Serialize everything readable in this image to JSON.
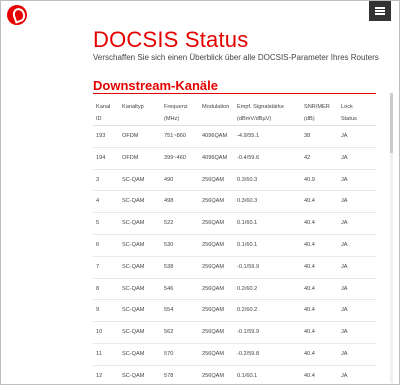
{
  "header": {
    "logo_icon": "vodafone-logo-icon",
    "menu_icon": "hamburger-menu-icon",
    "accent_color": "#e60000"
  },
  "page": {
    "title": "DOCSIS Status",
    "subtitle": "Verschaffen Sie sich einen Überblick über alle DOCSIS-Parameter Ihres Routers"
  },
  "downstream": {
    "section_title": "Downstream-Kanäle",
    "columns": [
      {
        "line1": "Kanal",
        "line2": "ID"
      },
      {
        "line1": "Kanaltyp",
        "line2": ""
      },
      {
        "line1": "Frequenz",
        "line2": "(MHz)"
      },
      {
        "line1": "Modulation",
        "line2": ""
      },
      {
        "line1": "Empf. Signalstärke",
        "line2": "(dBmV/dBµV)"
      },
      {
        "line1": "SNR/MER",
        "line2": "(dB)"
      },
      {
        "line1": "Lock",
        "line2": "Status"
      }
    ],
    "rows": [
      [
        "193",
        "OFDM",
        "751~860",
        "4096QAM",
        "-4.9/55.1",
        "38",
        "JA"
      ],
      [
        "194",
        "OFDM",
        "399~460",
        "4096QAM",
        "-0.4/59.6",
        "42",
        "JA"
      ],
      [
        "3",
        "SC-QAM",
        "490",
        "256QAM",
        "0.3/60.3",
        "40.9",
        "JA"
      ],
      [
        "4",
        "SC-QAM",
        "498",
        "256QAM",
        "0.3/60.3",
        "40.4",
        "JA"
      ],
      [
        "5",
        "SC-QAM",
        "522",
        "256QAM",
        "0.1/60.1",
        "40.4",
        "JA"
      ],
      [
        "6",
        "SC-QAM",
        "530",
        "256QAM",
        "0.1/60.1",
        "40.4",
        "JA"
      ],
      [
        "7",
        "SC-QAM",
        "538",
        "256QAM",
        "-0.1/59.9",
        "40.4",
        "JA"
      ],
      [
        "8",
        "SC-QAM",
        "546",
        "256QAM",
        "0.2/60.2",
        "40.4",
        "JA"
      ],
      [
        "9",
        "SC-QAM",
        "554",
        "256QAM",
        "0.2/60.2",
        "40.4",
        "JA"
      ],
      [
        "10",
        "SC-QAM",
        "562",
        "256QAM",
        "-0.1/59.9",
        "40.4",
        "JA"
      ],
      [
        "11",
        "SC-QAM",
        "570",
        "256QAM",
        "-0.2/59.8",
        "40.4",
        "JA"
      ],
      [
        "12",
        "SC-QAM",
        "578",
        "256QAM",
        "0.1/60.1",
        "40.4",
        "JA"
      ]
    ]
  }
}
